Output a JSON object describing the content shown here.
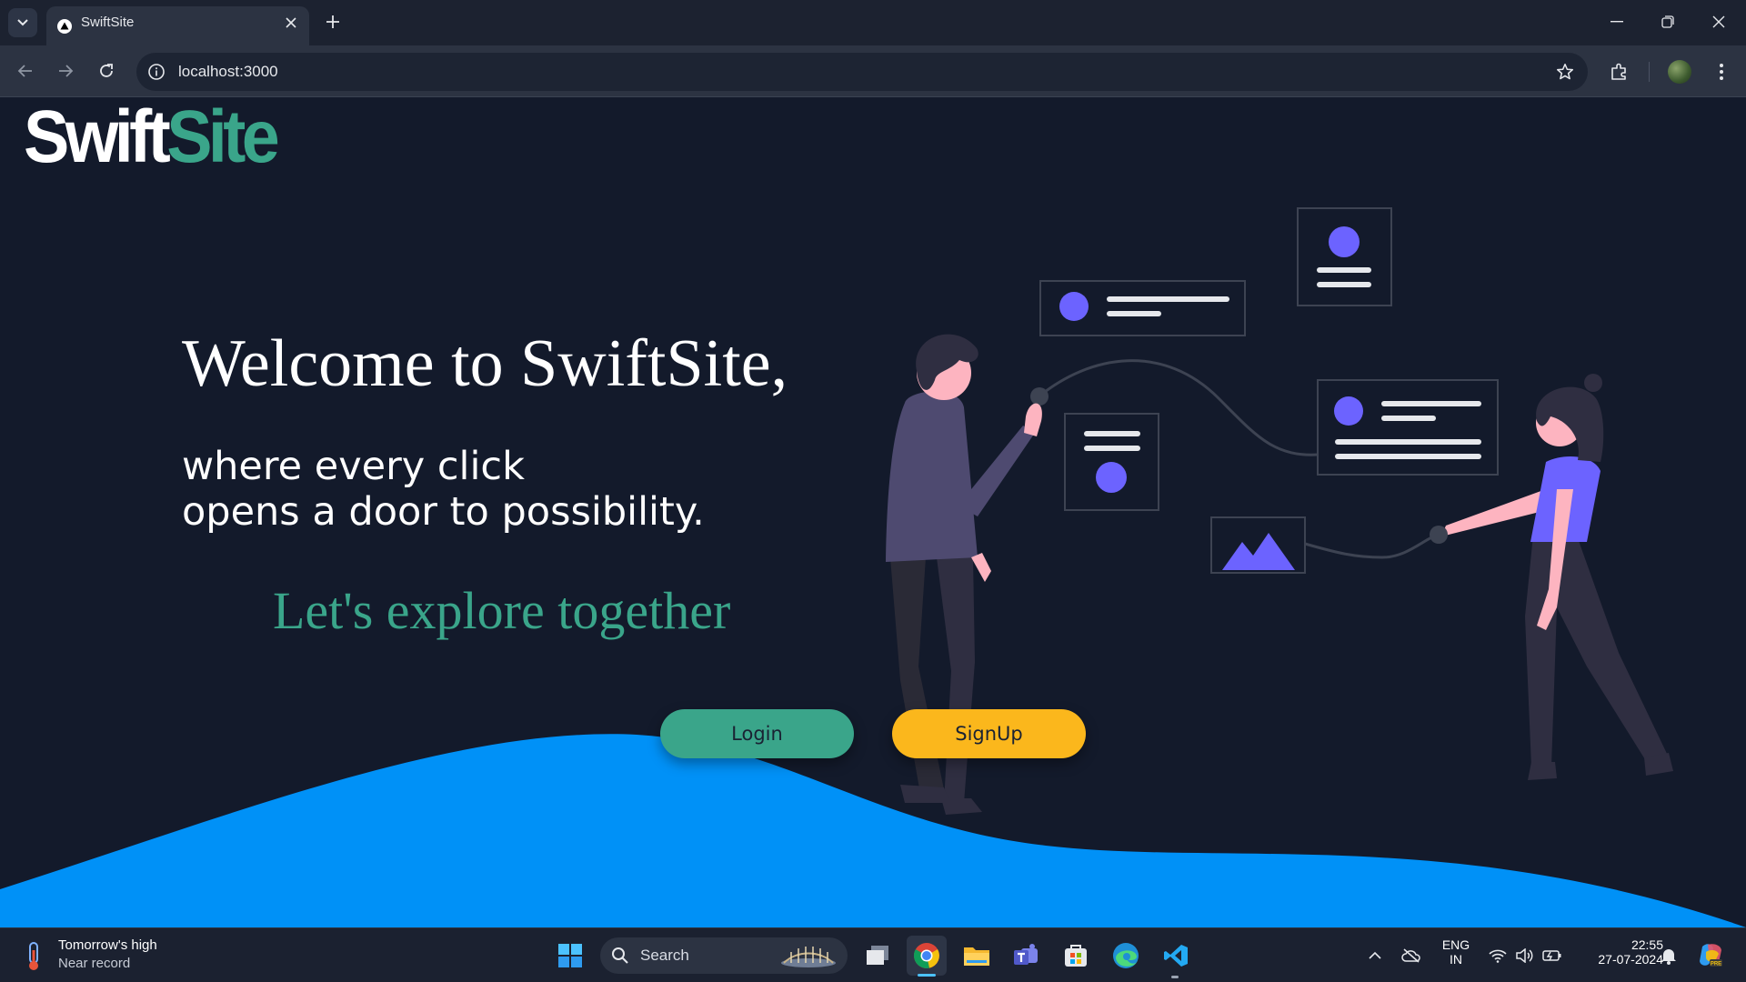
{
  "browser": {
    "tab_title": "SwiftSite",
    "url": "localhost:3000"
  },
  "page": {
    "logo_part1": "Swift",
    "logo_part2": "Site",
    "headline": "Welcome to SwiftSite,",
    "sub_line1": "where every click",
    "sub_line2": "opens a door to possibility.",
    "explore": "Let's explore together",
    "login_label": "Login",
    "signup_label": "SignUp"
  },
  "colors": {
    "background": "#131a2b",
    "accent_green": "#3aa58a",
    "accent_yellow": "#fbb71c",
    "wave_blue": "#0091f7",
    "illustration_purple": "#6c63ff"
  },
  "taskbar": {
    "weather_line1": "Tomorrow's high",
    "weather_line2": "Near record",
    "search_label": "Search",
    "lang_line1": "ENG",
    "lang_line2": "IN",
    "time": "22:55",
    "date": "27-07-2024"
  },
  "icons": [
    "tab-list-icon",
    "vercel-favicon",
    "close-icon",
    "plus-icon",
    "minimize-icon",
    "restore-icon",
    "window-close-icon",
    "back-icon",
    "forward-icon",
    "reload-icon",
    "site-info-icon",
    "bookmark-star-icon",
    "extensions-icon",
    "menu-dots-icon",
    "windows-start-icon",
    "search-icon",
    "task-view-icon",
    "chrome-icon",
    "file-explorer-icon",
    "teams-icon",
    "store-icon",
    "edge-icon",
    "vscode-icon",
    "chevron-up-icon",
    "onedrive-icon",
    "wifi-icon",
    "volume-icon",
    "battery-icon",
    "notification-bell-icon",
    "copilot-icon"
  ]
}
